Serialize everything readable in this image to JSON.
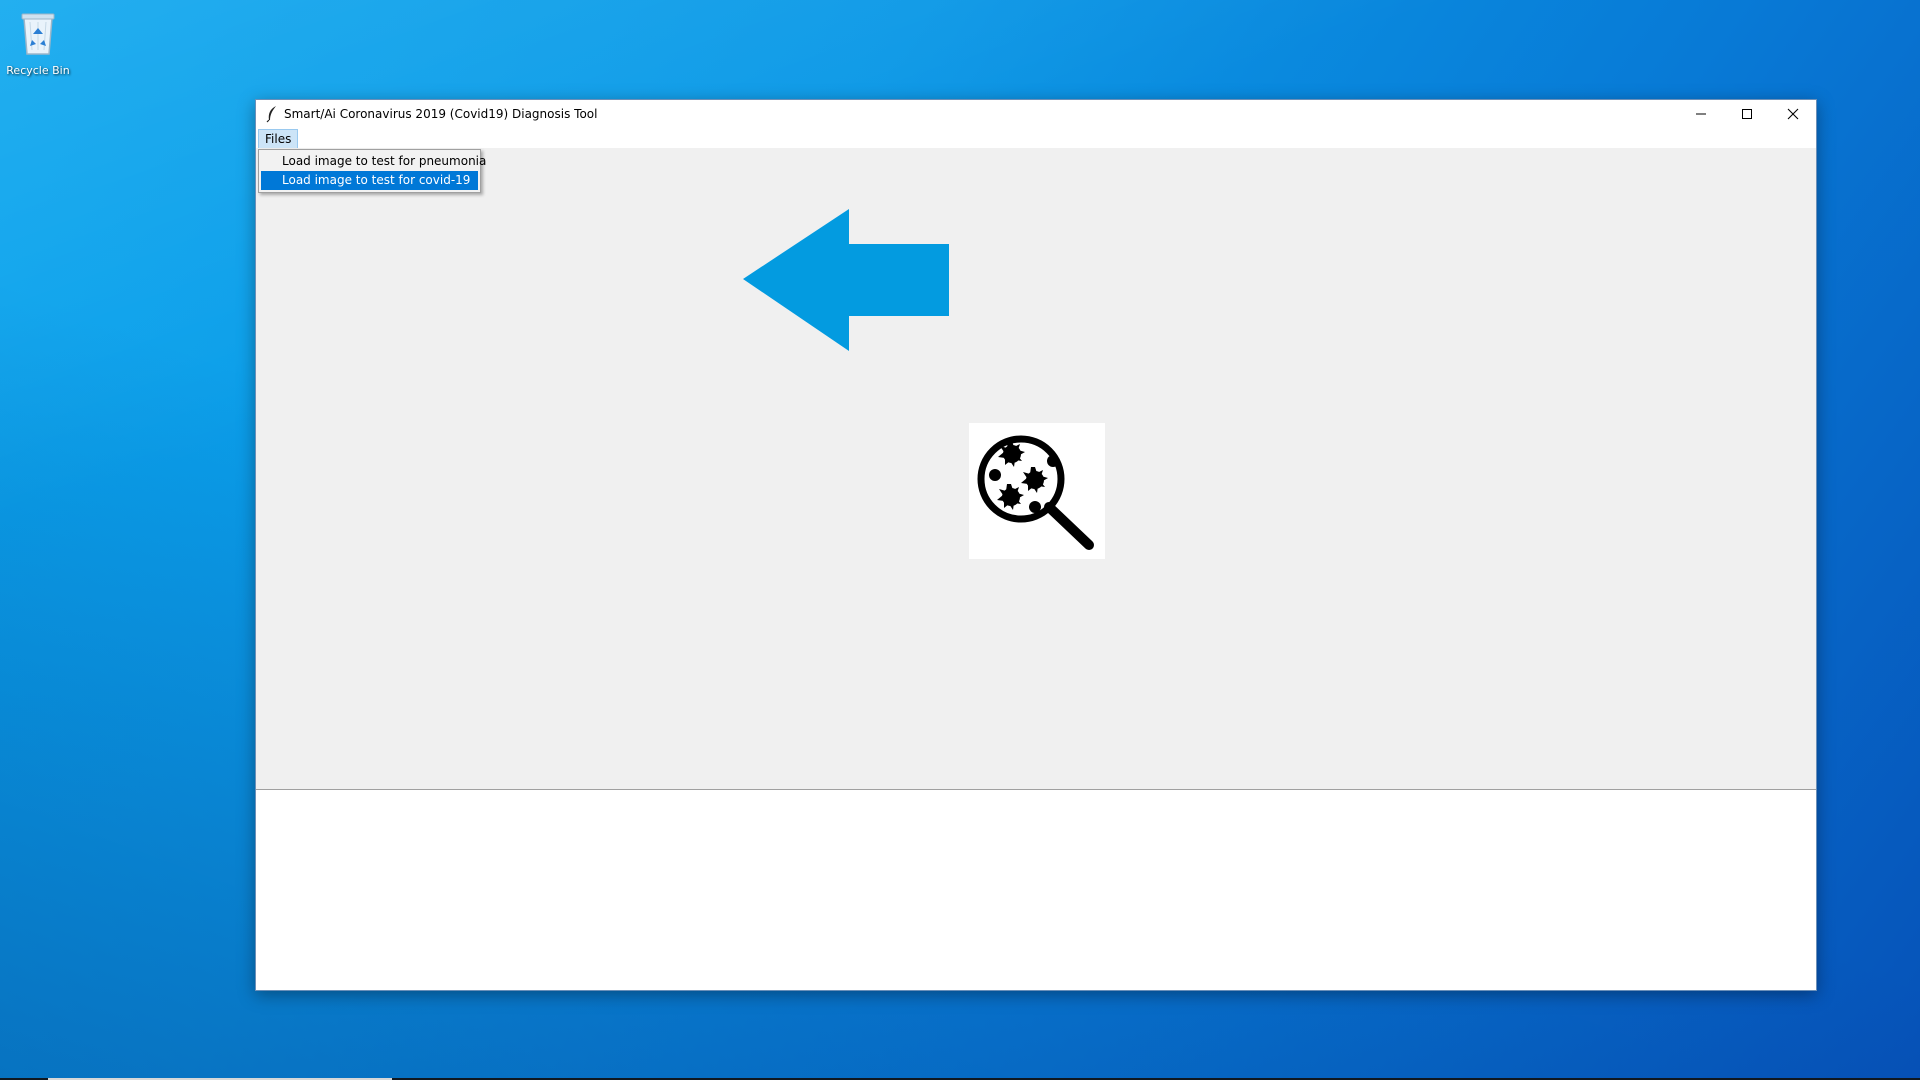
{
  "desktop": {
    "icons": [
      {
        "label": "Recycle Bin",
        "icon": "recycle-bin-icon"
      }
    ]
  },
  "window": {
    "title": "Smart/Ai Coronavirus 2019 (Covid19) Diagnosis Tool",
    "app_icon": "feather-icon",
    "controls": {
      "minimize": "minimize-icon",
      "maximize": "maximize-icon",
      "close": "close-icon"
    },
    "menu": {
      "files_label": "Files",
      "files_items": [
        {
          "label": "Load image to test for pneumonia",
          "selected": false
        },
        {
          "label": "Load image to test for covid-19",
          "selected": true
        }
      ]
    },
    "logo_icon": "virus-magnifier-icon",
    "output_text": ""
  },
  "colors": {
    "menu_highlight": "#0078d7",
    "arrow": "#039be0",
    "content_bg": "#f0f0f0"
  }
}
